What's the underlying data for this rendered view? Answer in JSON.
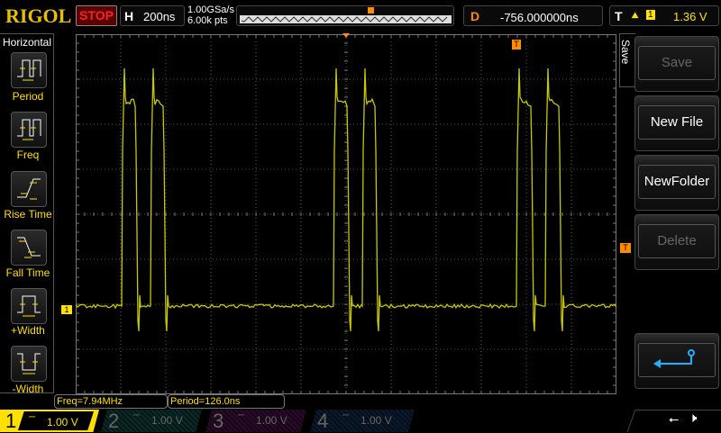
{
  "header": {
    "logo": "RIGOL",
    "run_state": "STOP",
    "h_label": "H",
    "timebase": "200ns",
    "sample_rate": "1.00GSa/s",
    "memory_depth": "6.00k pts",
    "delay_label": "D",
    "delay": "-756.000000ns",
    "trigger_label": "T",
    "trigger_source": "1",
    "trigger_level": "1.36 V"
  },
  "left_menu": {
    "title": "Horizontal",
    "items": [
      {
        "label": "Period"
      },
      {
        "label": "Freq"
      },
      {
        "label": "Rise Time"
      },
      {
        "label": "Fall Time"
      },
      {
        "label": "+Width"
      },
      {
        "label": "-Width"
      }
    ]
  },
  "right_menu": {
    "title": "Save",
    "buttons": [
      {
        "label": "Save",
        "enabled": false
      },
      {
        "label": "New File",
        "enabled": true
      },
      {
        "label": "NewFolder",
        "enabled": true
      },
      {
        "label": "Delete",
        "enabled": false
      }
    ]
  },
  "measurements": [
    {
      "text": "Freq=7.94MHz"
    },
    {
      "text": "Period=126.0ns"
    }
  ],
  "channels": [
    {
      "num": "1",
      "scale": "1.00 V",
      "color": "#ffff00",
      "active": true
    },
    {
      "num": "2",
      "scale": "1.00 V",
      "color": "#00c0a0",
      "active": false
    },
    {
      "num": "3",
      "scale": "1.00 V",
      "color": "#c000c0",
      "active": false
    },
    {
      "num": "4",
      "scale": "1.00 V",
      "color": "#2060ff",
      "active": false
    }
  ],
  "ch1_marker": "1",
  "trigger_marker": "T",
  "colors": {
    "trace": "#c8c800",
    "trigger": "#ff8c00",
    "accent": "#ffe000"
  }
}
